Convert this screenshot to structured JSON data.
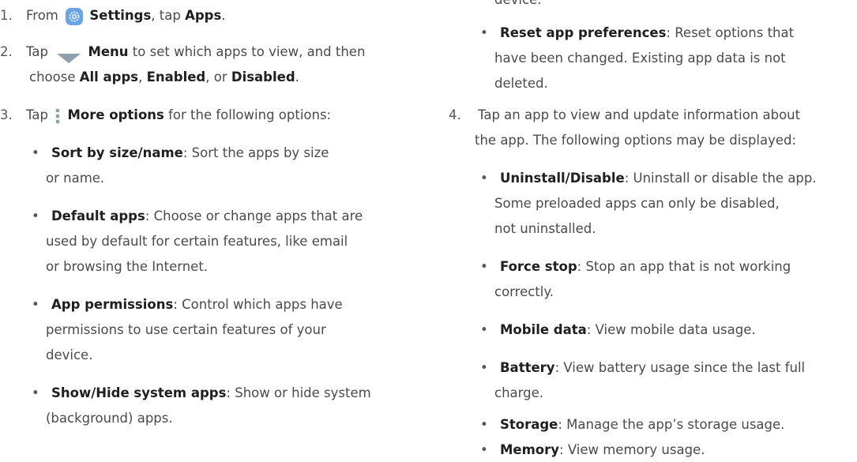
{
  "left": {
    "step1": {
      "num": "1.",
      "pre": "From",
      "bold1": "Settings",
      "mid": ", tap",
      "bold2": "Apps",
      "post": "."
    },
    "step2": {
      "num": "2.",
      "pre": "Tap",
      "bold1": "Menu",
      "post1": "to set which apps to view, and then",
      "pre2": "choose",
      "bold2": "All apps",
      "sep1": ",",
      "bold3": "Enabled",
      "sep2": ", or",
      "bold4": "Disabled",
      "post2": "."
    },
    "step3": {
      "num": "3.",
      "pre": "Tap",
      "bold": "More options",
      "post": "for the following options:"
    },
    "bullets": [
      {
        "term": "Sort by size/name",
        "lines": [
          ": Sort the apps by size",
          "or name."
        ]
      },
      {
        "term": "Default apps",
        "lines": [
          ": Choose or change apps that are",
          "used by default for certain features, like email",
          "or browsing the Internet."
        ]
      },
      {
        "term": "App permissions",
        "lines": [
          ": Control which apps have",
          "permissions to use certain features of your",
          "device."
        ]
      },
      {
        "term": "Show/Hide system apps",
        "lines": [
          ": Show or hide system",
          "(background) apps."
        ]
      }
    ]
  },
  "right": {
    "top_fragment": "device.",
    "reset": {
      "term": "Reset app preferences",
      "lines": [
        ": Reset options that",
        "have been changed. Existing app data is not",
        "deleted."
      ]
    },
    "step4": {
      "num": "4.",
      "lines": [
        "Tap an app to view and update information about",
        "the app. The following options may be displayed:"
      ]
    },
    "bullets": [
      {
        "term": "Uninstall/Disable",
        "lines": [
          ": Uninstall or disable the app.",
          "Some preloaded apps can only be disabled,",
          "not uninstalled."
        ]
      },
      {
        "term": "Force stop",
        "lines": [
          ": Stop an app that is not working",
          "correctly."
        ]
      },
      {
        "term": "Mobile data",
        "lines": [
          ": View mobile data usage."
        ]
      },
      {
        "term": "Battery",
        "lines": [
          ": View battery usage since the last full",
          "charge."
        ]
      },
      {
        "term": "Storage",
        "lines": [
          ": Manage the app’s storage usage."
        ]
      },
      {
        "term": "Memory",
        "lines": [
          ": View memory usage."
        ]
      }
    ]
  },
  "icons": {
    "settings": "settings-gear-icon",
    "menu": "menu-triangle-icon",
    "more": "more-options-icon"
  },
  "colors": {
    "settings_icon_bg": "#6aa4e8",
    "menu_icon": "#8fa0ad",
    "more_icon": "#8fa0ad"
  }
}
